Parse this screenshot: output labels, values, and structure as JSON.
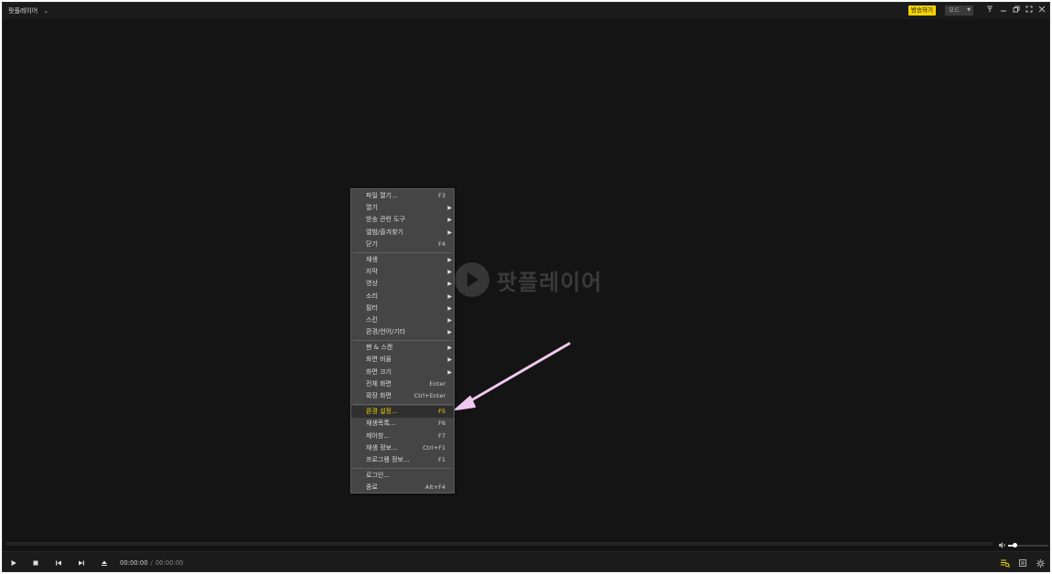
{
  "app": {
    "title": "팟플레이어",
    "broadcast_label": "방송하기",
    "mode_label": "모드",
    "logo_text": "팟플레이어"
  },
  "playback": {
    "current_time": "00:00:00",
    "separator": "/",
    "total_time": "00:00:00",
    "volume_fraction": 0.15
  },
  "menu": {
    "groups": [
      [
        {
          "label": "파일 열기...",
          "shortcut": "F3"
        },
        {
          "label": "열기",
          "submenu": true
        },
        {
          "label": "방송 관련 도구",
          "submenu": true
        },
        {
          "label": "앨범/즐겨찾기",
          "submenu": true
        },
        {
          "label": "닫기",
          "shortcut": "F4"
        }
      ],
      [
        {
          "label": "재생",
          "submenu": true
        },
        {
          "label": "자막",
          "submenu": true
        },
        {
          "label": "영상",
          "submenu": true
        },
        {
          "label": "소리",
          "submenu": true
        },
        {
          "label": "필터",
          "submenu": true
        },
        {
          "label": "스킨",
          "submenu": true
        },
        {
          "label": "환경/언어/기타",
          "submenu": true
        }
      ],
      [
        {
          "label": "팬 & 스캔",
          "submenu": true
        },
        {
          "label": "화면 비율",
          "submenu": true
        },
        {
          "label": "화면 크기",
          "submenu": true
        },
        {
          "label": "전체 화면",
          "shortcut": "Enter"
        },
        {
          "label": "확장 화면",
          "shortcut": "Ctrl+Enter"
        }
      ],
      [
        {
          "label": "환경 설정...",
          "shortcut": "F5",
          "active": true
        },
        {
          "label": "재생목록...",
          "shortcut": "F6"
        },
        {
          "label": "제어창...",
          "shortcut": "F7"
        },
        {
          "label": "재생 정보...",
          "shortcut": "Ctrl+F1"
        },
        {
          "label": "프로그램 정보...",
          "shortcut": "F1"
        }
      ],
      [
        {
          "label": "로그인..."
        },
        {
          "label": "종료",
          "shortcut": "Alt+F4"
        }
      ]
    ]
  },
  "colors": {
    "accent": "#f5d400",
    "menu_bg": "#454545",
    "annotation_arrow": "#f0c8f0"
  },
  "icons": [
    "chevron-down-icon",
    "pin-icon",
    "minimize-icon",
    "restore-icon",
    "fullscreen-icon",
    "close-icon",
    "play-icon",
    "stop-icon",
    "prev-icon",
    "next-icon",
    "eject-icon",
    "volume-icon",
    "playlist-icon",
    "control-panel-icon",
    "settings-icon"
  ]
}
